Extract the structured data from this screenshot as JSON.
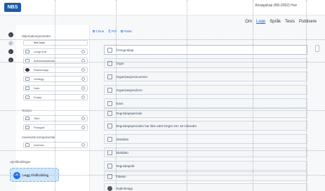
{
  "app": {
    "logo": "NBS",
    "title": "Ansøgskap (BR-0002) Hve"
  },
  "menu": [
    {
      "label": "Om",
      "active": false
    },
    {
      "label": "Lage",
      "active": true
    },
    {
      "label": "Språk",
      "active": false
    },
    {
      "label": "Tests",
      "active": false
    },
    {
      "label": "Publisere",
      "active": false
    }
  ],
  "rail": [
    {
      "icon": "info-icon",
      "glyph": "i"
    },
    {
      "icon": "search-icon",
      "glyph": "⌕"
    },
    {
      "icon": "info-icon",
      "glyph": "i"
    },
    {
      "icon": "info-icon",
      "glyph": "i"
    }
  ],
  "toolbar": {
    "clone": "⧉ Clone",
    "pdf": "⎘ Pdf",
    "paste": "⧉ Paste"
  },
  "palette": {
    "group1": "Skjemakomponenter",
    "dropdown_value": "Mal base",
    "components1": [
      {
        "label": "Langt svar",
        "icon": "textarea-icon"
      },
      {
        "label": "Avkrysningsboks",
        "icon": "checkbox-icon"
      },
      {
        "label": "Radioknapp",
        "icon": "radio-icon"
      },
      {
        "label": "Vedlegg",
        "icon": "attachment-icon"
      },
      {
        "label": "Dato",
        "icon": "calendar-icon"
      },
      {
        "label": "Knapp",
        "icon": "button-icon"
      }
    ],
    "group2": "Tekster",
    "components2": [
      {
        "label": "Tittel",
        "icon": "title-icon"
      },
      {
        "label": "Paragraf",
        "icon": "paragraph-icon"
      }
    ],
    "group3": "Avanserte komponenter",
    "components3": [
      {
        "label": "Adresse",
        "icon": "address-icon"
      }
    ],
    "api_label": "Api-tilkoblinger",
    "add_label": "Legg til tilkobling"
  },
  "fields": [
    {
      "label": "Årsregnskap",
      "icon": "title-icon",
      "selected": true
    },
    {
      "label": "Orgnr",
      "icon": "text-icon",
      "selected": false
    },
    {
      "label": "Organisasjonsnummer",
      "icon": "line-icon",
      "selected": false
    },
    {
      "label": "Organisasjonsform",
      "icon": "line-icon",
      "selected": false
    },
    {
      "label": "Navn",
      "icon": "line-icon",
      "selected": false
    },
    {
      "label": "Regnskapsperiode",
      "icon": "title-icon",
      "selected": false
    },
    {
      "label": "Regnskapsperioden har ikke vært lengre enn 18 måneder",
      "icon": "checkbox-icon",
      "selected": false
    },
    {
      "label": "Startdato",
      "icon": "calendar-icon",
      "selected": false
    },
    {
      "label": "Sluttdato",
      "icon": "calendar-icon",
      "selected": false
    },
    {
      "label": "Regnskapsår",
      "icon": "line-icon",
      "selected": false
    },
    {
      "label": "Tittelen",
      "icon": "title-icon",
      "selected": false
    },
    {
      "label": "Radioknapp",
      "icon": "radio-icon",
      "selected": false
    }
  ]
}
